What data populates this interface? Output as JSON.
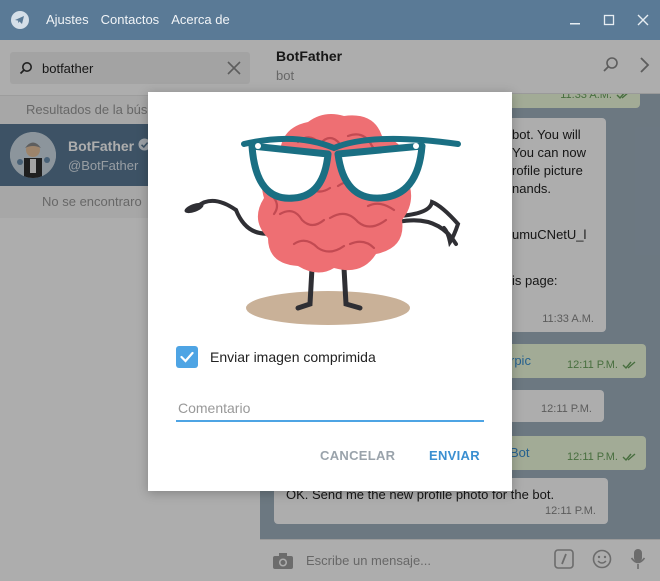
{
  "titlebar": {
    "menu": [
      "Ajustes",
      "Contactos",
      "Acerca de"
    ]
  },
  "search": {
    "value": "botfather"
  },
  "results": {
    "header": "Resultados de la bús",
    "item": {
      "name": "BotFather",
      "username": "@BotFather"
    },
    "none_found": "No se encontraro"
  },
  "chat": {
    "name": "BotFather",
    "status": "bot",
    "messages": [
      {
        "type": "out",
        "text": "",
        "time": "11:33 A.M."
      },
      {
        "type": "in",
        "lines": [
          "bot. You will",
          "You can now",
          "rofile picture",
          "nands.",
          "",
          "umuCNetU_l",
          "",
          "is page:"
        ],
        "time": "11:33 A.M."
      },
      {
        "type": "out",
        "text": "rpic",
        "time": "12:11 P.M."
      },
      {
        "type": "in",
        "text": "",
        "time": "12:11 P.M."
      },
      {
        "type": "out",
        "text": "Bot",
        "time": "12:11 P.M."
      },
      {
        "type": "in",
        "text": "OK. Send me the new profile photo for the bot.",
        "time": "12:11 P.M."
      }
    ],
    "composer_placeholder": "Escribe un mensaje..."
  },
  "modal": {
    "compress_label": "Enviar imagen comprimida",
    "compress_checked": true,
    "comment_placeholder": "Comentario",
    "cancel_label": "CANCELAR",
    "send_label": "ENVIAR"
  },
  "colors": {
    "titlebar": "#5a7a96",
    "accent": "#4ea4e4",
    "selected_row": "#5a7a96",
    "out_bubble": "#effdde"
  }
}
